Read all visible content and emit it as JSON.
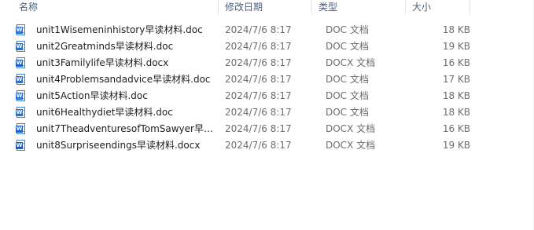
{
  "columns": {
    "name": "名称",
    "date": "修改日期",
    "type": "类型",
    "size": "大小"
  },
  "files": [
    {
      "name": "unit1Wisemeninhistory早读材料.doc",
      "date": "2024/7/6 8:17",
      "type": "DOC 文档",
      "size": "18 KB",
      "icon": "word-doc-icon"
    },
    {
      "name": "unit2Greatminds早读材料.doc",
      "date": "2024/7/6 8:17",
      "type": "DOC 文档",
      "size": "19 KB",
      "icon": "word-doc-icon"
    },
    {
      "name": "unit3Familylife早读材料.docx",
      "date": "2024/7/6 8:17",
      "type": "DOCX 文档",
      "size": "16 KB",
      "icon": "word-docx-icon"
    },
    {
      "name": "unit4Problemsandadvice早读材料.doc",
      "date": "2024/7/6 8:17",
      "type": "DOC 文档",
      "size": "17 KB",
      "icon": "word-doc-icon"
    },
    {
      "name": "unit5Action早读材料.doc",
      "date": "2024/7/6 8:17",
      "type": "DOC 文档",
      "size": "18 KB",
      "icon": "word-doc-icon"
    },
    {
      "name": "unit6Healthydiet早读材料.doc",
      "date": "2024/7/6 8:17",
      "type": "DOC 文档",
      "size": "18 KB",
      "icon": "word-doc-icon"
    },
    {
      "name": "unit7TheadventuresofTomSawyer早读...",
      "date": "2024/7/6 8:17",
      "type": "DOCX 文档",
      "size": "16 KB",
      "icon": "word-docx-icon"
    },
    {
      "name": "unit8Surpriseendings早读材料.docx",
      "date": "2024/7/6 8:17",
      "type": "DOCX 文档",
      "size": "19 KB",
      "icon": "word-docx-icon"
    }
  ]
}
